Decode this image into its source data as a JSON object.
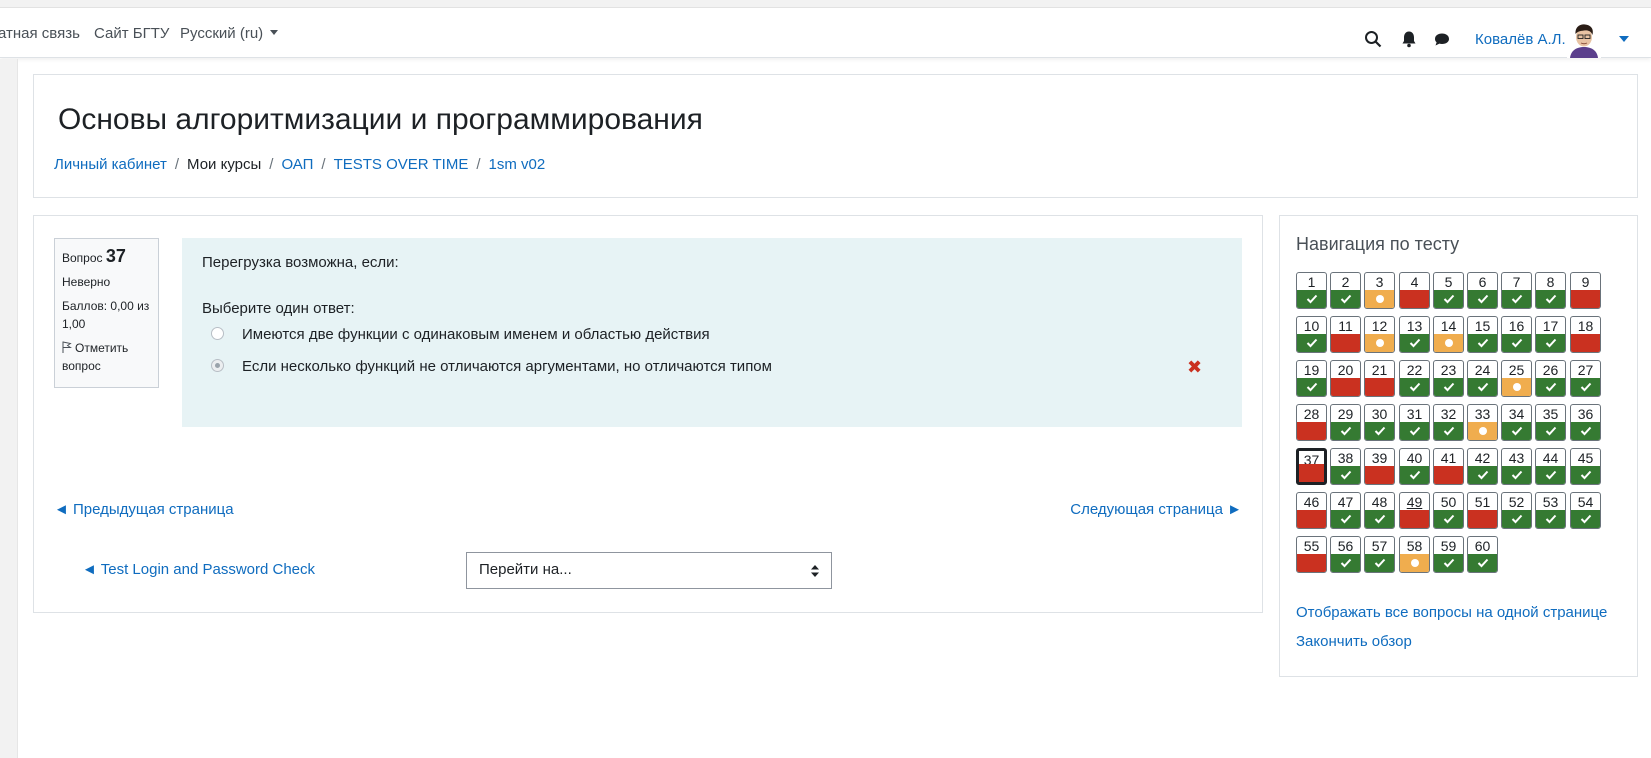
{
  "navbar": {
    "links": [
      "атная связь",
      "Сайт БГТУ"
    ],
    "language": "Русский ‎(ru)‎",
    "user_name": "Ковалёв А.Л."
  },
  "header": {
    "title": "Основы алгоритмизации и программирования",
    "breadcrumb": [
      {
        "label": "Личный кабинет",
        "link": true
      },
      {
        "label": "Мои курсы",
        "link": false
      },
      {
        "label": "ОАП",
        "link": true
      },
      {
        "label": "TESTS OVER TIME",
        "link": true
      },
      {
        "label": "1sm v02",
        "link": true
      }
    ]
  },
  "question": {
    "label": "Вопрос",
    "number": "37",
    "state": "Неверно",
    "grade": "Баллов: 0,00 из 1,00",
    "flag_label": "Отметить вопрос",
    "text": "Перегрузка возможна, если:",
    "prompt": "Выберите один ответ:",
    "answers": [
      {
        "text": "Имеются две функции с одинаковым именем и областью действия",
        "selected": false
      },
      {
        "text": "Если несколько функций не отличаются аргументами, но отличаются типом",
        "selected": true
      }
    ]
  },
  "paging": {
    "prev": "◄ Предыдущая страница",
    "next": "Следующая страница ►",
    "activity_link": "◄ Test Login and Password Check",
    "jump_placeholder": "Перейти на..."
  },
  "quiz_nav": {
    "title": "Навигация по тесту",
    "current": 37,
    "states": [
      "correct",
      "correct",
      "partial",
      "incorrect",
      "correct",
      "correct",
      "correct",
      "correct",
      "incorrect",
      "correct",
      "incorrect",
      "partial",
      "correct",
      "partial",
      "correct",
      "correct",
      "correct",
      "incorrect",
      "correct",
      "incorrect",
      "incorrect",
      "correct",
      "correct",
      "correct",
      "partial",
      "correct",
      "correct",
      "incorrect",
      "correct",
      "correct",
      "correct",
      "correct",
      "partial",
      "correct",
      "correct",
      "correct",
      "incorrect",
      "correct",
      "incorrect",
      "correct",
      "incorrect",
      "correct",
      "correct",
      "correct",
      "correct",
      "incorrect",
      "correct",
      "correct",
      "incorrect",
      "correct",
      "incorrect",
      "correct",
      "correct",
      "correct",
      "incorrect",
      "correct",
      "correct",
      "partial",
      "correct",
      "correct"
    ],
    "underlined": [
      49
    ],
    "show_all": "Отображать все вопросы на одной странице",
    "finish": "Закончить обзор"
  },
  "colors": {
    "link": "#0f6cbf",
    "correct": "#357a32",
    "incorrect": "#ca3120",
    "partial": "#f0ad4e",
    "formulation_bg": "#e7f3f5"
  }
}
